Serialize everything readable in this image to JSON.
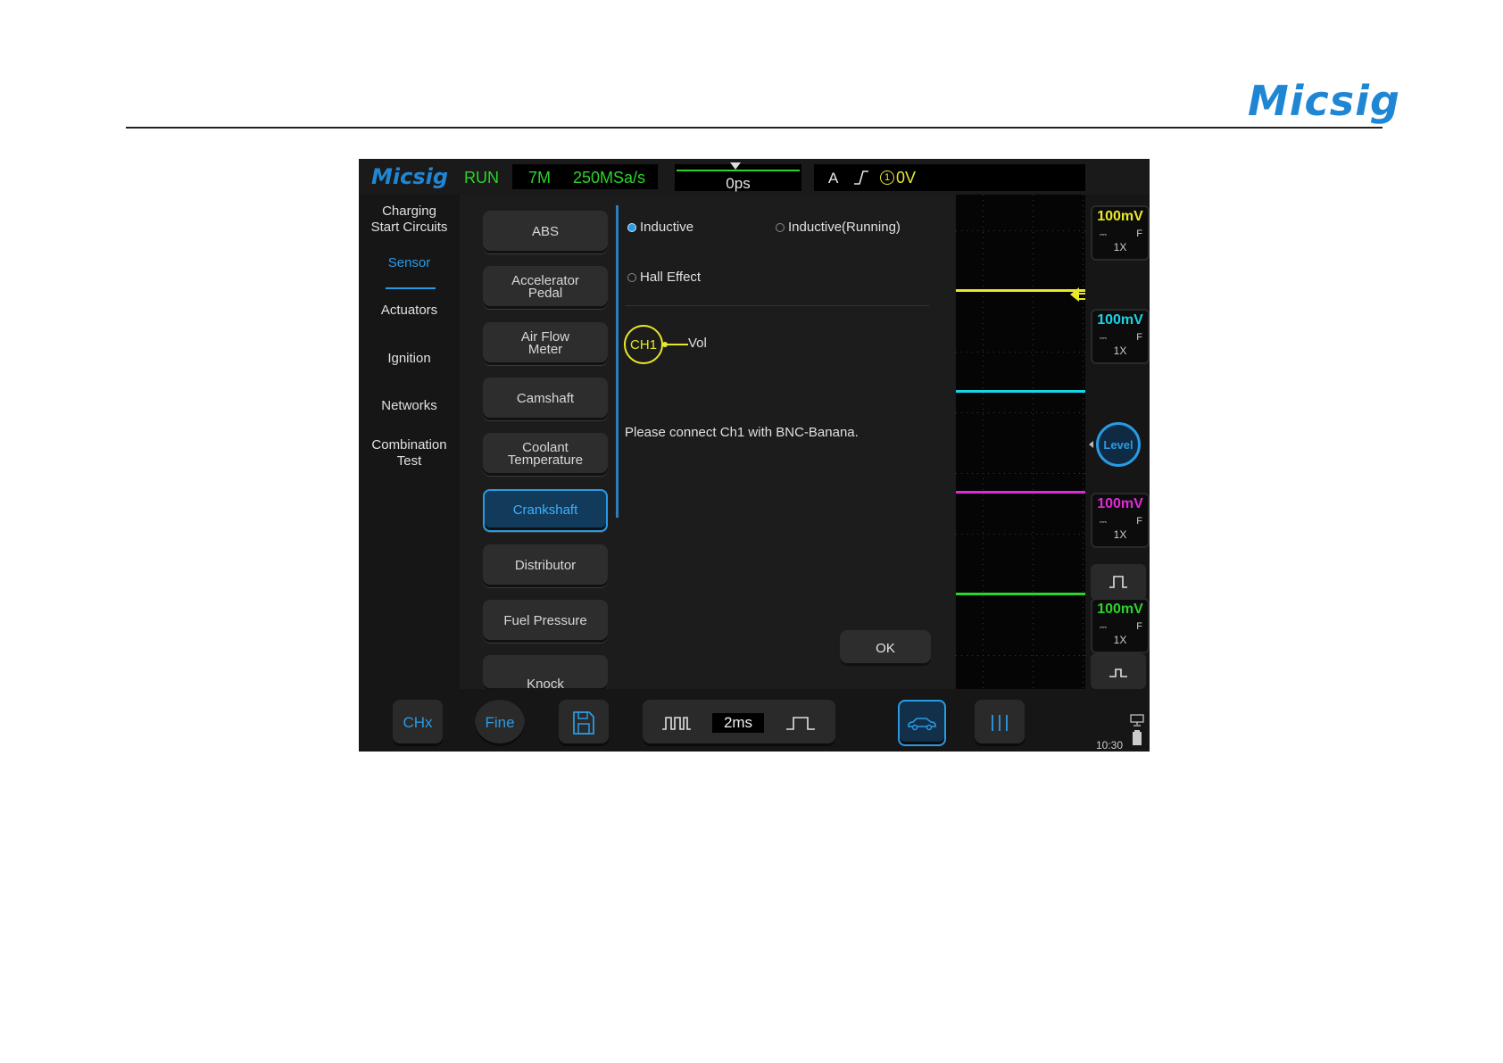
{
  "document": {
    "logo_text": "Micsig"
  },
  "topbar": {
    "logo_text": "Micsig",
    "run_status": "RUN",
    "memory_depth": "7M",
    "sample_rate": "250MSa/s",
    "time_offset": "0ps",
    "trigger_mode": "A",
    "trigger_source": "1",
    "trigger_level": "0V"
  },
  "nav": {
    "items": [
      {
        "label_line1": "Charging",
        "label_line2": "Start Circuits"
      },
      {
        "label_line1": "Sensor",
        "label_line2": ""
      },
      {
        "label_line1": "Actuators",
        "label_line2": ""
      },
      {
        "label_line1": "Ignition",
        "label_line2": ""
      },
      {
        "label_line1": "Networks",
        "label_line2": ""
      },
      {
        "label_line1": "Combination",
        "label_line2": "Test"
      }
    ],
    "active": "Sensor"
  },
  "sensors": {
    "items": [
      {
        "line1": "ABS",
        "line2": ""
      },
      {
        "line1": "Accelerator",
        "line2": "Pedal"
      },
      {
        "line1": "Air Flow",
        "line2": "Meter"
      },
      {
        "line1": "Camshaft",
        "line2": ""
      },
      {
        "line1": "Coolant",
        "line2": "Temperature"
      },
      {
        "line1": "Crankshaft",
        "line2": ""
      },
      {
        "line1": "Distributor",
        "line2": ""
      },
      {
        "line1": "Fuel Pressure",
        "line2": ""
      },
      {
        "line1": "Knock",
        "line2": ""
      }
    ],
    "selected": "Crankshaft"
  },
  "panel": {
    "options": [
      {
        "label": "Inductive",
        "selected": true
      },
      {
        "label": "Inductive(Running)",
        "selected": false
      },
      {
        "label": "Hall Effect",
        "selected": false
      }
    ],
    "probe_channel": "CH1",
    "probe_label": "Vol",
    "instruction": "Please connect Ch1 with BNC-Banana.",
    "ok_label": "OK"
  },
  "channels": [
    {
      "scale": "100mV",
      "coupling": "⎓",
      "bandwidth": "F",
      "probe": "1X",
      "color": "#e8e82a"
    },
    {
      "scale": "100mV",
      "coupling": "⎓",
      "bandwidth": "F",
      "probe": "1X",
      "color": "#19d3e8"
    },
    {
      "scale": "100mV",
      "coupling": "⎓",
      "bandwidth": "F",
      "probe": "1X",
      "color": "#e02ad8"
    },
    {
      "scale": "100mV",
      "coupling": "⎓",
      "bandwidth": "F",
      "probe": "1X",
      "color": "#2bd42b"
    }
  ],
  "right": {
    "level_label": "Level",
    "clock": "10:30"
  },
  "bottombar": {
    "chx_label": "CHx",
    "fine_label": "Fine",
    "timebase": "2ms"
  },
  "icons": {
    "save": "save-icon",
    "timebase_decrease": "pulse-train-icon",
    "timebase_increase": "single-pulse-icon",
    "auto": "car-icon",
    "cursor": "cursor-lines-icon"
  }
}
